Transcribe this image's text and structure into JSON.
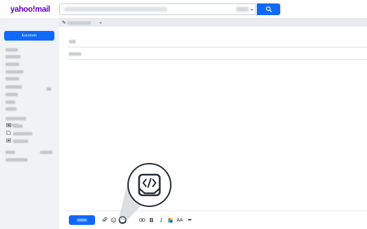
{
  "header": {
    "logo_text": "yahoo!mail",
    "search": {
      "placeholder": "",
      "filter_label": ""
    }
  },
  "sidebar": {
    "compose_label": "Escrever",
    "unread_badge": "21",
    "section_toggle": "^"
  },
  "compose": {
    "tab_chevron": "⌄"
  },
  "toolbar": {
    "bold_label": "B",
    "italic_label": "I",
    "font_size_label": "AA",
    "more_label": "•••"
  },
  "colors": {
    "brand": "#6001d2",
    "accent": "#0f69ff",
    "sidebar_bg": "#f1f2f5"
  },
  "icons": [
    "search-icon",
    "chevron-down-icon",
    "pencil-icon",
    "attach-icon",
    "emoji-icon",
    "code-embed-icon",
    "link-icon",
    "color-palette-icon",
    "more-icon"
  ]
}
